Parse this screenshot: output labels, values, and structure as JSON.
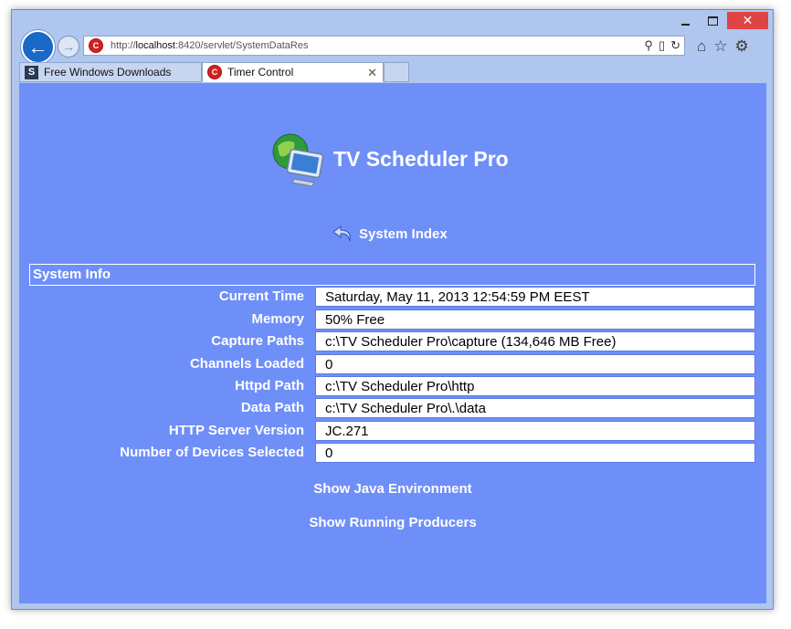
{
  "browser": {
    "url_prefix": "http://",
    "url_host": "localhost",
    "url_rest": ":8420/servlet/SystemDataRes",
    "tabs": [
      {
        "label": "Free Windows Downloads"
      },
      {
        "label": "Timer Control"
      }
    ]
  },
  "page": {
    "app_title": "TV Scheduler Pro",
    "system_index_label": "System Index",
    "section_title": "System Info",
    "rows": [
      {
        "label": "Current Time",
        "value": "Saturday, May 11, 2013 12:54:59 PM EEST"
      },
      {
        "label": "Memory",
        "value": "50% Free"
      },
      {
        "label": "Capture Paths",
        "value": "c:\\TV Scheduler Pro\\capture (134,646 MB Free)"
      },
      {
        "label": "Channels Loaded",
        "value": "0"
      },
      {
        "label": "Httpd Path",
        "value": "c:\\TV Scheduler Pro\\http"
      },
      {
        "label": "Data Path",
        "value": "c:\\TV Scheduler Pro\\.\\data"
      },
      {
        "label": "HTTP Server Version",
        "value": "JC.271"
      },
      {
        "label": "Number of Devices Selected",
        "value": "0"
      }
    ],
    "link_java": "Show Java Environment",
    "link_producers": "Show Running Producers"
  },
  "colors": {
    "page_background": "#6f8ff8",
    "close_button": "#e04343"
  }
}
